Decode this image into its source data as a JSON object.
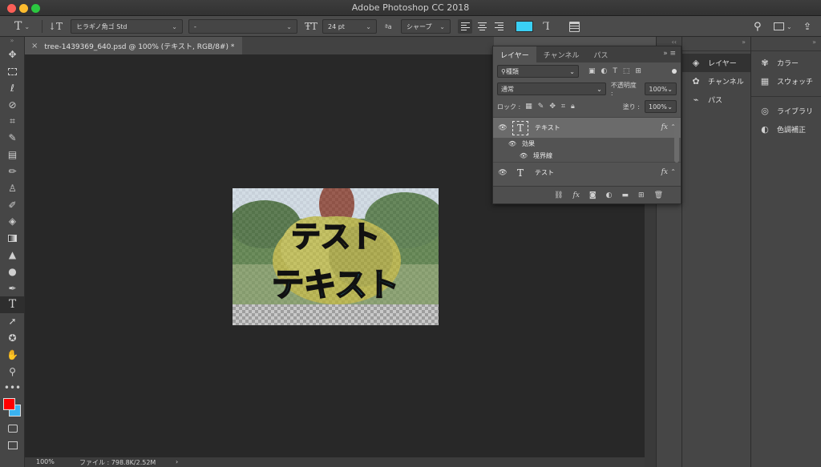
{
  "window": {
    "title": "Adobe Photoshop CC 2018"
  },
  "options_bar": {
    "tool_icon": "text-tool-icon",
    "orientation_icon": "text-orientation-icon",
    "font_family": "ヒラギノ角ゴ Std",
    "font_style": "-",
    "font_size": "24 pt",
    "antialias_label": "ªa",
    "antialias": "シャープ",
    "text_color": "#3ad0f5",
    "panel_icon": "character-panel-icon"
  },
  "document": {
    "tab_title": "tree-1439369_640.psd @ 100% (テキスト, RGB/8#) *",
    "text_layer_top": "テスト",
    "text_layer_bottom": "テキスト",
    "top_text_color": "#f4f11c",
    "bottom_text_color": "#37c6ff"
  },
  "status": {
    "zoom": "100%",
    "file_info": "ファイル : 798.8K/2.52M",
    "arrow": "›"
  },
  "toolbar": {
    "tools": [
      "move",
      "marquee",
      "lasso",
      "quick-select",
      "crop",
      "eyedropper",
      "healing",
      "brush",
      "stamp",
      "history-brush",
      "eraser",
      "gradient",
      "blur",
      "dodge",
      "pen",
      "type",
      "path-select",
      "shape",
      "hand",
      "zoom",
      "more"
    ],
    "foreground_color": "#ff0000",
    "background_color": "#3bb3f0"
  },
  "layers_panel": {
    "tabs": [
      "レイヤー",
      "チャンネル",
      "パス"
    ],
    "filter_kind": "種類",
    "blend_mode": "通常",
    "opacity_label": "不透明度 :",
    "opacity": "100%",
    "lock_label": "ロック :",
    "fill_label": "塗り :",
    "fill": "100%",
    "layers": [
      {
        "name": "テキスト",
        "type": "T",
        "fx": "fx"
      },
      {
        "name": "テスト",
        "type": "T",
        "fx": "fx"
      }
    ],
    "effects_label": "効果",
    "stroke_label": "境界線"
  },
  "dock_mid": {
    "items": [
      "レイヤー",
      "チャンネル",
      "パス"
    ]
  },
  "dock_right": {
    "group1": [
      "カラー",
      "スウォッチ"
    ],
    "group2": [
      "ライブラリ",
      "色調補正"
    ]
  }
}
